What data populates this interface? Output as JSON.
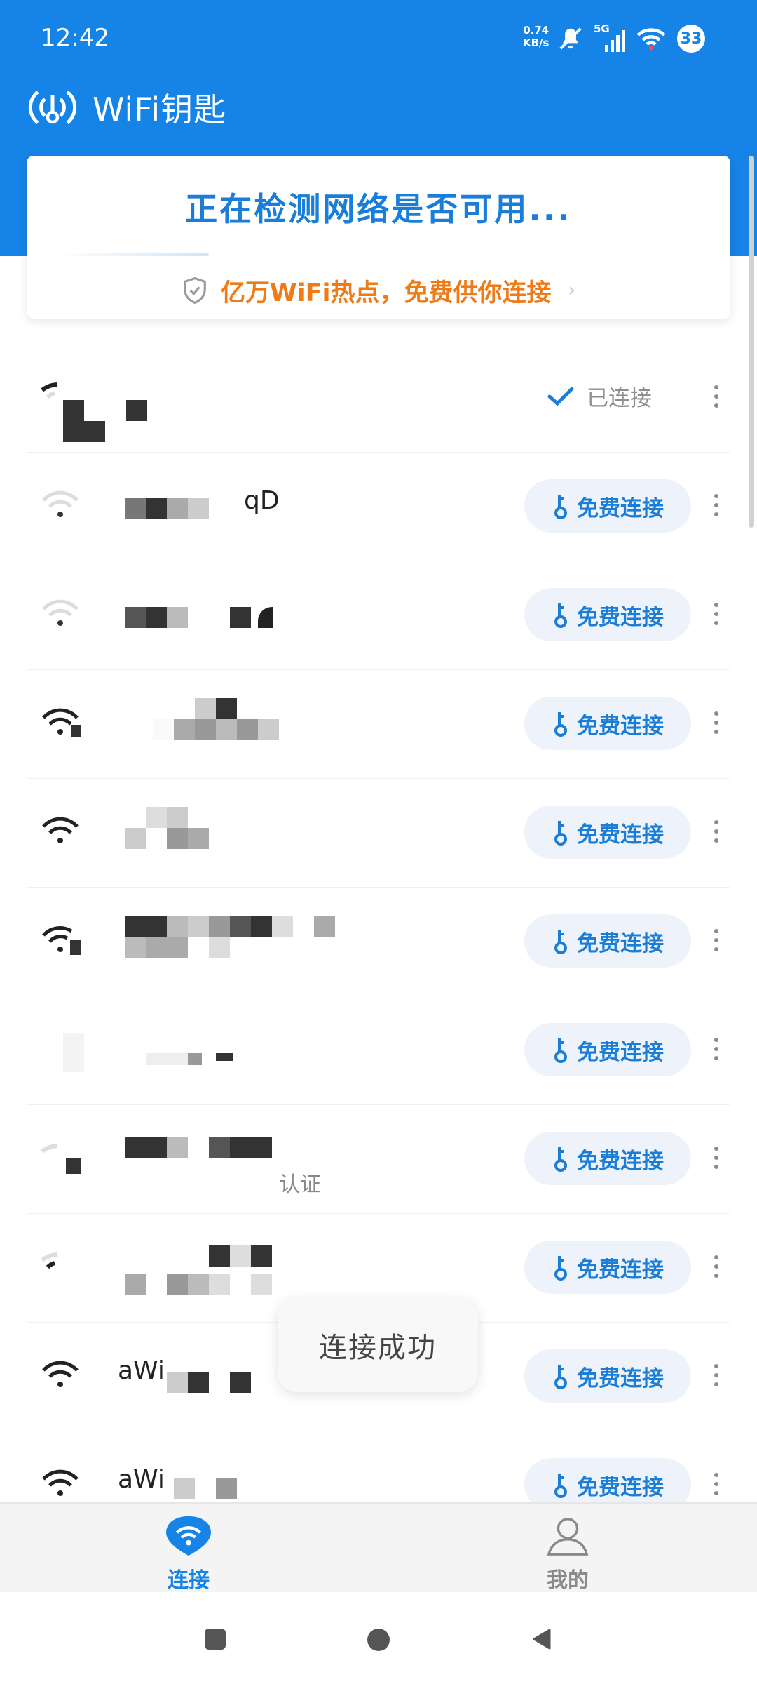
{
  "status_bar": {
    "time": "12:42",
    "speed_value": "0.74",
    "speed_unit": "KB/s",
    "network": "5G",
    "battery": "33"
  },
  "app": {
    "title": "WiFi钥匙",
    "accent_color": "#1683e6"
  },
  "detect": {
    "message": "正在检测网络是否可用...",
    "hotspot_text": "亿万WiFi热点，免费供你连接",
    "hotspot_chevron": "›"
  },
  "wifi_list": {
    "connected_label": "已连接",
    "connect_label": "免费连接",
    "rows": [
      {
        "ssid": "",
        "status": "connected",
        "signal": 1
      },
      {
        "ssid": "qD",
        "status": "free",
        "signal": 1
      },
      {
        "ssid": "",
        "status": "free",
        "signal": 1
      },
      {
        "ssid": "",
        "status": "free",
        "signal": 3
      },
      {
        "ssid": "",
        "status": "free",
        "signal": 3
      },
      {
        "ssid": "",
        "status": "free",
        "signal": 2
      },
      {
        "ssid": "",
        "status": "free",
        "signal": 0
      },
      {
        "ssid": "认证",
        "status": "free",
        "signal": 1
      },
      {
        "ssid": "",
        "status": "free",
        "signal": 1
      },
      {
        "ssid": "aWi",
        "status": "free",
        "signal": 3
      },
      {
        "ssid": "aWi",
        "status": "free",
        "signal": 3
      }
    ]
  },
  "toast": {
    "message": "连接成功"
  },
  "bottom_nav": {
    "connect_label": "连接",
    "mine_label": "我的"
  }
}
